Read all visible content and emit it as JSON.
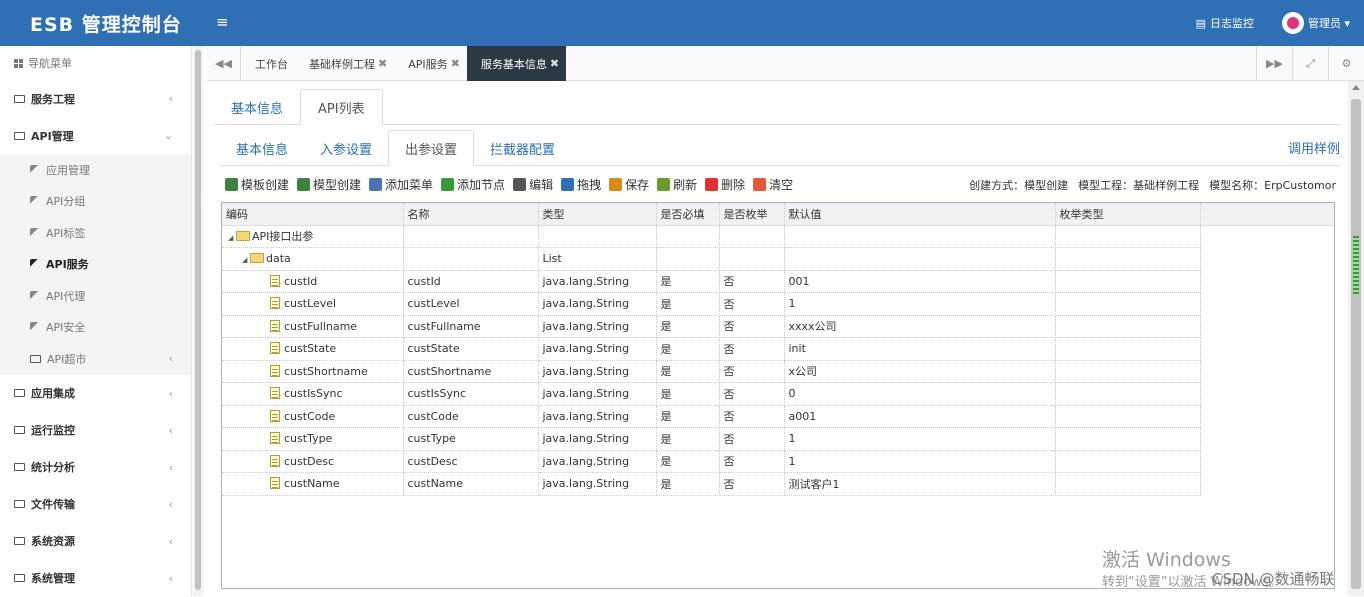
{
  "app": {
    "title": "ESB 管理控制台",
    "log_monitor": "日志监控",
    "user": "管理员 ▾"
  },
  "sidebar": {
    "header": "导航菜单",
    "items": [
      {
        "label": "服务工程"
      },
      {
        "label": "API管理"
      },
      {
        "label": "应用集成"
      },
      {
        "label": "运行监控"
      },
      {
        "label": "统计分析"
      },
      {
        "label": "文件传输"
      },
      {
        "label": "系统资源"
      },
      {
        "label": "系统管理"
      }
    ],
    "sub": [
      {
        "label": "应用管理"
      },
      {
        "label": "API分组"
      },
      {
        "label": "API标签"
      },
      {
        "label": "API服务"
      },
      {
        "label": "API代理"
      },
      {
        "label": "API安全"
      },
      {
        "label": "API超市"
      }
    ]
  },
  "tabs": [
    {
      "label": "工作台"
    },
    {
      "label": "基础样例工程"
    },
    {
      "label": "API服务"
    },
    {
      "label": "服务基本信息"
    }
  ],
  "level1_tabs": [
    {
      "label": "基本信息"
    },
    {
      "label": "API列表"
    }
  ],
  "level2_tabs": [
    {
      "label": "基本信息"
    },
    {
      "label": "入参设置"
    },
    {
      "label": "出参设置"
    },
    {
      "label": "拦截器配置"
    }
  ],
  "sample_link": "调用样例",
  "toolbar": [
    {
      "label": "模板创建",
      "icon": "template-icon",
      "color": "#3f7f3f"
    },
    {
      "label": "模型创建",
      "icon": "model-icon",
      "color": "#3f7f3f"
    },
    {
      "label": "添加菜单",
      "icon": "add-menu-icon",
      "color": "#4a73b0"
    },
    {
      "label": "添加节点",
      "icon": "add-node-icon",
      "color": "#3a9a3a"
    },
    {
      "label": "编辑",
      "icon": "edit-icon",
      "color": "#555555"
    },
    {
      "label": "拖拽",
      "icon": "drag-icon",
      "color": "#2f6fb5"
    },
    {
      "label": "保存",
      "icon": "save-icon",
      "color": "#d88a1a"
    },
    {
      "label": "刷新",
      "icon": "refresh-icon",
      "color": "#6a9a2a"
    },
    {
      "label": "删除",
      "icon": "delete-icon",
      "color": "#d33"
    },
    {
      "label": "清空",
      "icon": "clear-icon",
      "color": "#e05a3a"
    }
  ],
  "meta": {
    "create_mode": "创建方式：模型创建",
    "model_project": "模型工程：基础样例工程",
    "model_name": "模型名称：ErpCustomor"
  },
  "grid": {
    "columns": [
      "编码",
      "名称",
      "类型",
      "是否必填",
      "是否枚举",
      "默认值",
      "枚举类型"
    ],
    "rows": [
      {
        "code": "API接口出参",
        "name": "",
        "type": "",
        "required": "",
        "enum": "",
        "default": "",
        "enum_type": ""
      },
      {
        "code": "data",
        "name": "",
        "type": "List",
        "required": "",
        "enum": "",
        "default": "",
        "enum_type": ""
      },
      {
        "code": "custId",
        "name": "custId",
        "type": "java.lang.String",
        "required": "是",
        "enum": "否",
        "default": "001",
        "enum_type": ""
      },
      {
        "code": "custLevel",
        "name": "custLevel",
        "type": "java.lang.String",
        "required": "是",
        "enum": "否",
        "default": "1",
        "enum_type": ""
      },
      {
        "code": "custFullname",
        "name": "custFullname",
        "type": "java.lang.String",
        "required": "是",
        "enum": "否",
        "default": "xxxx公司",
        "enum_type": ""
      },
      {
        "code": "custState",
        "name": "custState",
        "type": "java.lang.String",
        "required": "是",
        "enum": "否",
        "default": "init",
        "enum_type": ""
      },
      {
        "code": "custShortname",
        "name": "custShortname",
        "type": "java.lang.String",
        "required": "是",
        "enum": "否",
        "default": "x公司",
        "enum_type": ""
      },
      {
        "code": "custIsSync",
        "name": "custIsSync",
        "type": "java.lang.String",
        "required": "是",
        "enum": "否",
        "default": "0",
        "enum_type": ""
      },
      {
        "code": "custCode",
        "name": "custCode",
        "type": "java.lang.String",
        "required": "是",
        "enum": "否",
        "default": "a001",
        "enum_type": ""
      },
      {
        "code": "custType",
        "name": "custType",
        "type": "java.lang.String",
        "required": "是",
        "enum": "否",
        "default": "1",
        "enum_type": ""
      },
      {
        "code": "custDesc",
        "name": "custDesc",
        "type": "java.lang.String",
        "required": "是",
        "enum": "否",
        "default": "1",
        "enum_type": ""
      },
      {
        "code": "custName",
        "name": "custName",
        "type": "java.lang.String",
        "required": "是",
        "enum": "否",
        "default": "测试客户1",
        "enum_type": ""
      }
    ]
  },
  "watermark": {
    "line1": "激活 Windows",
    "line2": "转到“设置”以激活 Windows。",
    "csdn": "CSDN @数通畅联"
  }
}
